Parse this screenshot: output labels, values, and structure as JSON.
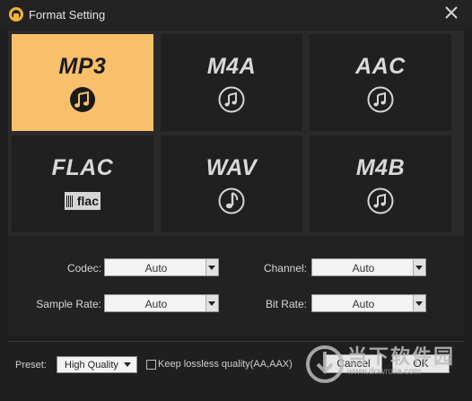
{
  "window": {
    "title": "Format Setting"
  },
  "formats": [
    {
      "label": "MP3",
      "selected": true,
      "icon": "music-note-icon"
    },
    {
      "label": "M4A",
      "selected": false,
      "icon": "music-note-icon"
    },
    {
      "label": "AAC",
      "selected": false,
      "icon": "music-note-icon"
    },
    {
      "label": "FLAC",
      "selected": false,
      "icon": "flac-icon",
      "icon_text": "flac"
    },
    {
      "label": "WAV",
      "selected": false,
      "icon": "music-note-icon"
    },
    {
      "label": "M4B",
      "selected": false,
      "icon": "music-note-icon"
    }
  ],
  "settings": {
    "codec": {
      "label": "Codec:",
      "value": "Auto"
    },
    "channel": {
      "label": "Channel:",
      "value": "Auto"
    },
    "sample_rate": {
      "label": "Sample Rate:",
      "value": "Auto"
    },
    "bit_rate": {
      "label": "Bit Rate:",
      "value": "Auto"
    }
  },
  "footer": {
    "preset_label": "Preset:",
    "preset_value": "High Quality",
    "lossless_label": "Keep lossless quality(AA,AAX)",
    "lossless_checked": false,
    "cancel_label": "Cancel",
    "ok_label": "OK"
  },
  "watermark": {
    "text": "当下软件园",
    "url": "www.downxia.com"
  },
  "colors": {
    "selected_tile": "#f8c06a",
    "tile": "#202020",
    "background": "#1f1f1f"
  }
}
